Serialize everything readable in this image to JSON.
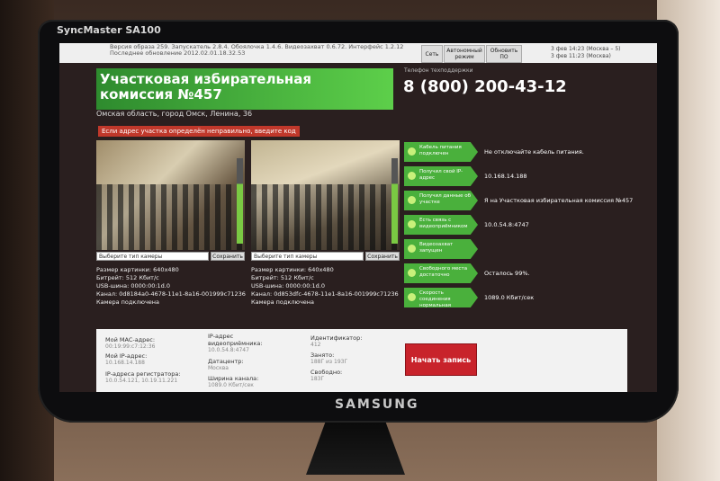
{
  "monitor": {
    "model": "SyncMaster SA100",
    "brand": "SAMSUNG"
  },
  "topbar": {
    "info_line1": "Версия образа 259. Запускатель 2.8.4. Обоялочка 1.4.6. Видеозахват 0.6.72. Интерфейс 1.2.12",
    "info_line2": "Последнее обновление 2012.02.01.18.32.53",
    "buttons": [
      "Сеть",
      "Автономный режим",
      "Обновить ПО"
    ],
    "time_line1": "3 фев 14:23 (Москва – 5)",
    "time_line2": "3 фев 11:23 (Москва)"
  },
  "header": {
    "title": "Участковая избирательная комиссия №457",
    "address": "Омская область, город Омск, Ленина, 36",
    "hotline_label": "Телефон техподдержки",
    "hotline": "8 (800) 200-43-12",
    "warning": "Если адрес участка определён неправильно, введите код"
  },
  "cameras": [
    {
      "select": "Выберите тип камеры",
      "save": "Сохранить",
      "size": "Размер картинки: 640х480",
      "bitrate": "Битрейт: 512 Кбит/с",
      "usb": "USB-шина: 0000:00:1d.0",
      "channel": "Канал: 0d8184a0-4678-11e1-8a16-001999c71236",
      "state": "Камера подключена"
    },
    {
      "select": "Выберите тип камеры",
      "save": "Сохранить",
      "size": "Размер картинки: 640х480",
      "bitrate": "Битрейт: 512 Кбит/с",
      "usb": "USB-шина: 0000:00:1d.0",
      "channel": "Канал: 0d853dfc-4678-11e1-8a16-001999c71236",
      "state": "Камера подключена"
    }
  ],
  "statuses": [
    {
      "label": "Кабель питания подключен",
      "value": "Не отключайте кабель питания."
    },
    {
      "label": "Получил свой IP-адрес",
      "value": "10.168.14.188"
    },
    {
      "label": "Получил данные об участке",
      "value": "Я на Участковая избирательная комиссия №457"
    },
    {
      "label": "Есть связь с видеоприёмником",
      "value": "10.0.54.8:4747"
    },
    {
      "label": "Видеозахват запущен",
      "value": ""
    },
    {
      "label": "Свободного места достаточно",
      "value": "Осталось 99%."
    },
    {
      "label": "Скорость соединения нормальная",
      "value": "1089.0 Кбит/сек"
    }
  ],
  "bottom": {
    "mac_label": "Мой MAC-адрес:",
    "mac": "00:19:99:c7:12:36",
    "ip_label": "Мой IP-адрес:",
    "ip": "10.168.14.188",
    "reg_label": "IP-адреса регистратора:",
    "reg": "10.0.54.121, 10.19.11.221",
    "recv_label": "IP-адрес видеоприёмника:",
    "recv": "10.0.54.8:4747",
    "dc_label": "Датацентр:",
    "dc": "Москва",
    "bw_label": "Ширина канала:",
    "bw": "1089.0 Кбит/сек",
    "id_label": "Идентификатор:",
    "id": "412",
    "used_label": "Занято:",
    "used": "188Г из 193Г",
    "free_label": "Свободно:",
    "free": "183Г",
    "start": "Начать запись"
  }
}
